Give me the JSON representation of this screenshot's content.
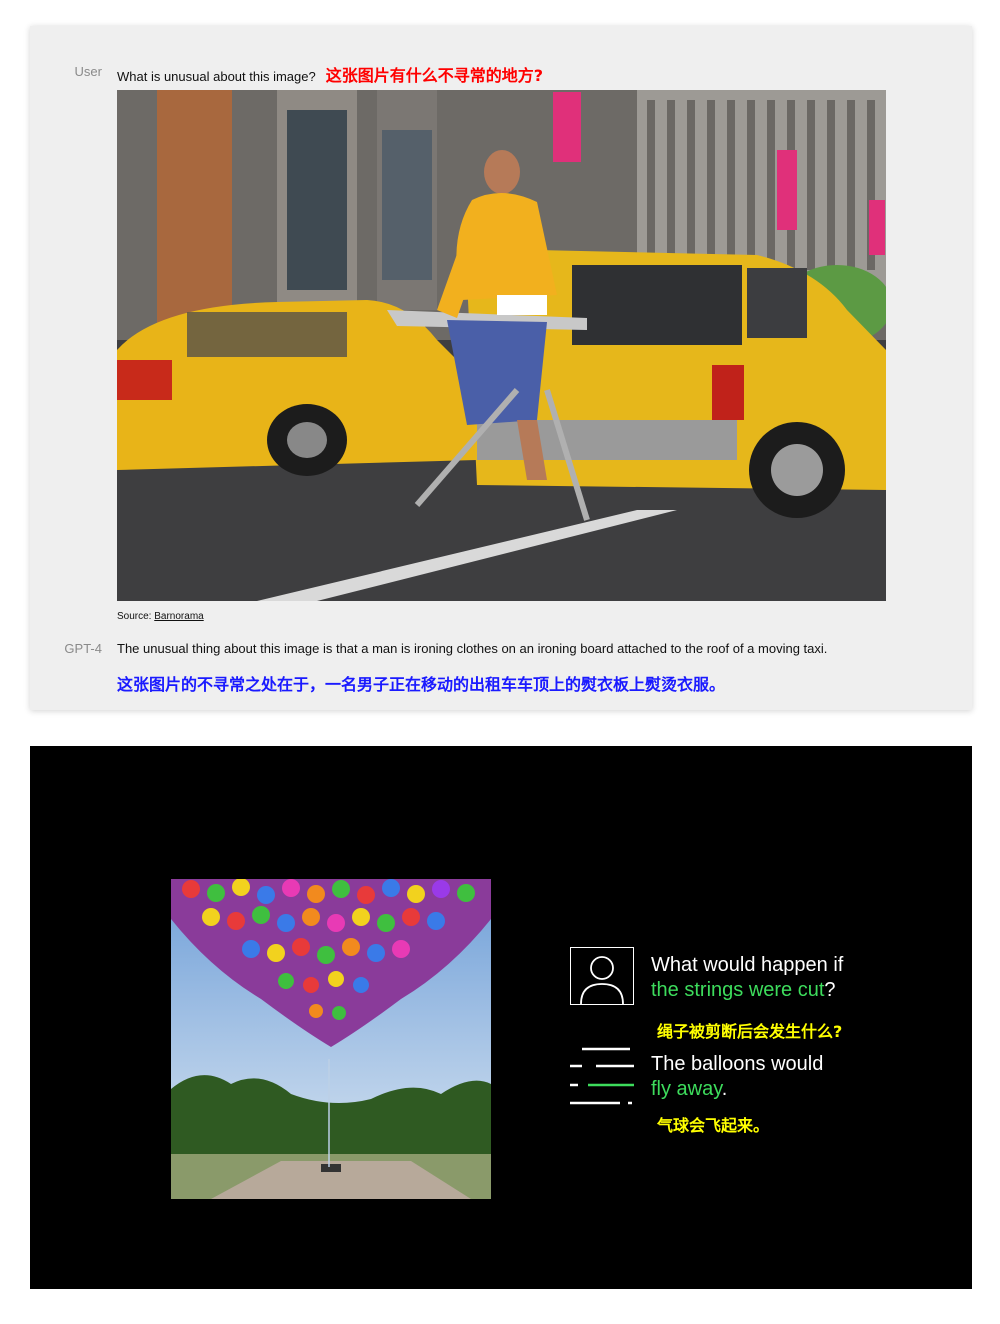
{
  "panel1": {
    "user_role": "User",
    "user_question": "What is unusual about this image?",
    "user_question_cn": "这张图片有什么不寻常的地方?",
    "source_label": "Source:",
    "source_link": "Barnorama",
    "gpt_role": "GPT-4",
    "gpt_answer": "The unusual thing about this image is that a man is ironing clothes on an ironing board attached to the roof of a moving taxi.",
    "gpt_answer_cn": "这张图片的不寻常之处在于，一名男子正在移动的出租车车顶上的熨衣板上熨烫衣服。"
  },
  "panel2": {
    "question_line1": "What would happen if",
    "question_line2_green": "the strings were cut",
    "question_line2_end": "?",
    "question_cn": "绳子被剪断后会发生什么?",
    "answer_line1": "The balloons would",
    "answer_line2_green": "fly away",
    "answer_line2_end": ".",
    "answer_cn": "气球会飞起来。"
  },
  "colors": {
    "accent_green": "#3ddc5c",
    "cn_red": "#ff0000",
    "cn_blue": "#1a1aff",
    "cn_yellow": "#ffff00"
  }
}
